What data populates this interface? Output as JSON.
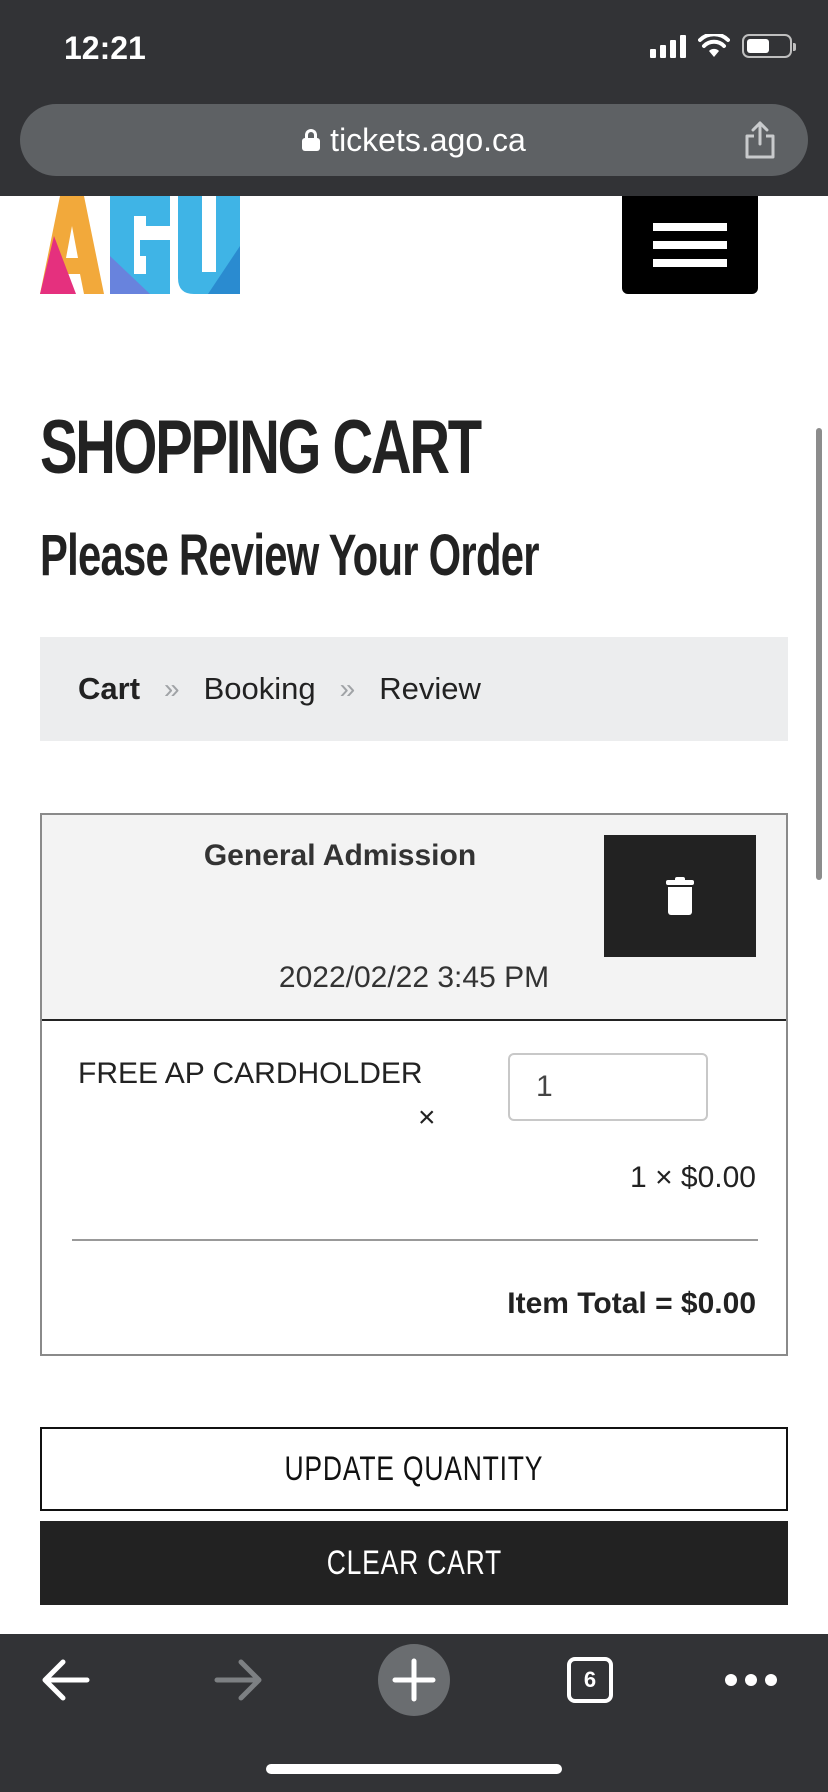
{
  "status_bar": {
    "time": "12:21"
  },
  "browser": {
    "url": "tickets.ago.ca",
    "tab_count": "6"
  },
  "site": {
    "logo_text": "AGO",
    "logo_colors": [
      "#f2a93b",
      "#e5307e",
      "#3fb4e6",
      "#2a8bd0"
    ]
  },
  "page": {
    "title": "SHOPPING CART",
    "subtitle": "Please Review Your Order"
  },
  "breadcrumb": {
    "steps": [
      "Cart",
      "Booking",
      "Review"
    ],
    "separator": "»",
    "current_index": 0
  },
  "cart": {
    "item": {
      "name": "General Admission",
      "datetime": "2022/02/22 3:45 PM",
      "ticket_type": "FREE AP CARDHOLDER",
      "remove_symbol": "×",
      "quantity": "1",
      "unit_price_line": "1 × $0.00",
      "total_line": "Item Total = $0.00"
    }
  },
  "actions": {
    "update_label": "UPDATE QUANTITY",
    "clear_label": "CLEAR CART"
  },
  "colors": {
    "chrome": "#323336",
    "breadcrumb_bg": "#ecedee",
    "dark_button": "#222222"
  }
}
